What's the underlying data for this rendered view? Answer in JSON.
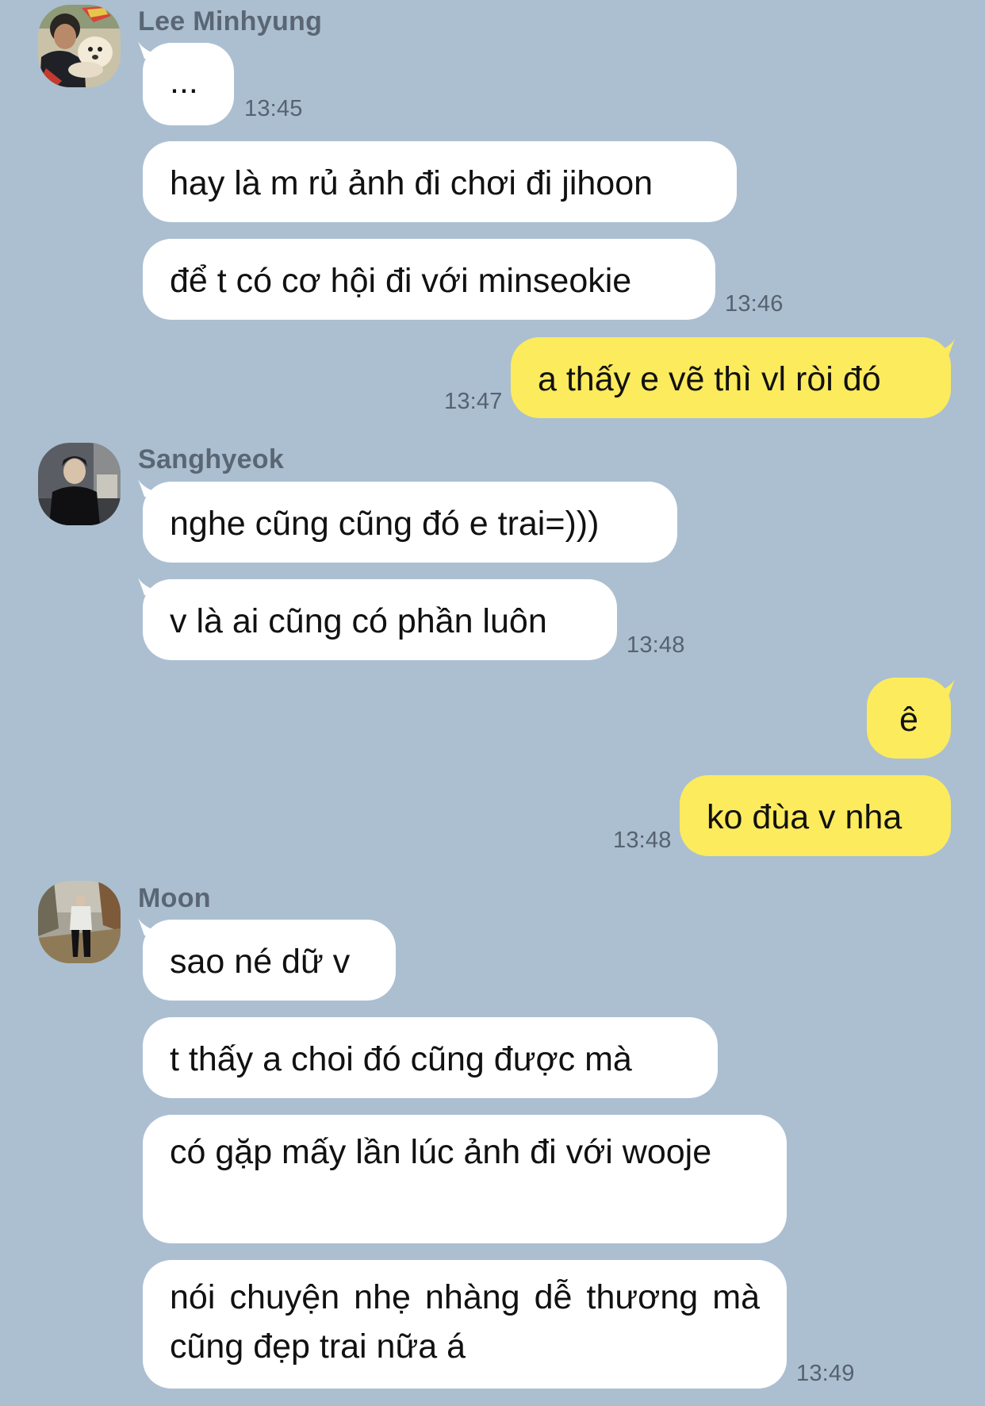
{
  "chat": {
    "groups": [
      {
        "sender": "Lee Minhyung",
        "avatar": "avatar-lee-minhyung",
        "messages": [
          {
            "text": "...",
            "time": "13:45"
          },
          {
            "text": "hay là m rủ ảnh đi chơi đi jihoon"
          },
          {
            "text": "để t có cơ hội đi với minseokie",
            "time": "13:46"
          }
        ]
      },
      {
        "sender": "me",
        "messages": [
          {
            "text": "a thấy e vẽ thì vl ròi đó",
            "time": "13:47"
          }
        ]
      },
      {
        "sender": "Sanghyeok",
        "avatar": "avatar-sanghyeok",
        "messages": [
          {
            "text": "nghe cũng cũng đó e trai=)))"
          },
          {
            "text": "v là ai cũng có phần luôn",
            "time": "13:48"
          }
        ]
      },
      {
        "sender": "me",
        "messages": [
          {
            "text": "ê"
          },
          {
            "text": "ko đùa v nha",
            "time": "13:48"
          }
        ]
      },
      {
        "sender": "Moon",
        "avatar": "avatar-moon",
        "messages": [
          {
            "text": "sao né dữ v"
          },
          {
            "text": "t thấy a choi đó cũng được mà"
          },
          {
            "text": "có gặp mấy lần lúc ảnh đi với wooje"
          },
          {
            "text": "nói chuyện nhẹ nhàng dễ thương mà cũng đẹp trai nữa á",
            "time": "13:49"
          }
        ]
      }
    ]
  },
  "colors": {
    "background": "#abbfd1",
    "incoming_bubble": "#ffffff",
    "outgoing_bubble": "#fceb5c",
    "name_text": "#5a6673",
    "time_text": "#56626f"
  }
}
